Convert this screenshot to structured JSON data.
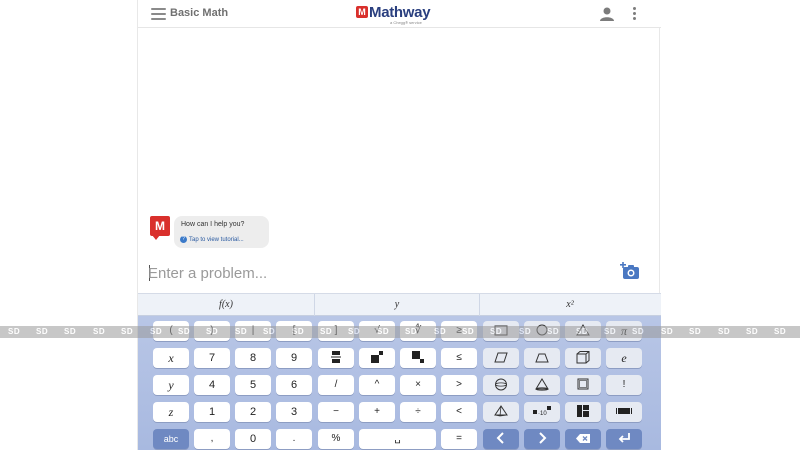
{
  "header": {
    "title": "Basic Math",
    "logo_mark": "M",
    "logo_word": "Mathway",
    "logo_sub": "a Chegg® service",
    "icons": [
      "menu-icon",
      "user-icon",
      "more-vert-icon"
    ]
  },
  "chat": {
    "message": "How can I help you?",
    "tutorial_link": "Tap to view tutorial...",
    "help_glyph": "?"
  },
  "input": {
    "placeholder": "Enter a problem...",
    "camera_icon": "add-photo-icon"
  },
  "tabs": [
    {
      "label": "f(x)"
    },
    {
      "label": "y"
    },
    {
      "label": "x²"
    }
  ],
  "keys": {
    "paren_open": "(",
    "paren_close": ")",
    "abs": "|",
    "bracket_open": "[",
    "bracket_close": "]",
    "sqrt": "√",
    "nthroot": "∜",
    "geq": "≥",
    "pi": "π",
    "x": "x",
    "seven": "7",
    "eight": "8",
    "nine": "9",
    "leq": "≤",
    "e": "e",
    "y": "y",
    "four": "4",
    "five": "5",
    "six": "6",
    "slash": "/",
    "caret": "^",
    "times": "×",
    "gt": ">",
    "factorial": "!",
    "z": "z",
    "one": "1",
    "two": "2",
    "three": "3",
    "minus": "−",
    "plus": "+",
    "divide": "÷",
    "lt": "<",
    "abc": "abc",
    "comma": ",",
    "zero": "0",
    "dot": ".",
    "percent": "%",
    "space": "␣",
    "equals": "="
  },
  "watermark": "SD",
  "colors": {
    "brand_red": "#d9302c",
    "brand_blue": "#2a3f7f",
    "keyboard_bg": "#b3c2e4",
    "key_dark": "#6f89c2"
  }
}
